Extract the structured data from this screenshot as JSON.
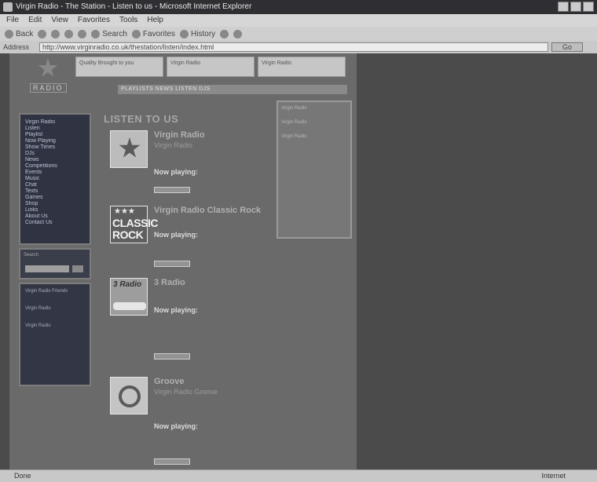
{
  "window": {
    "title": "Virgin Radio - The Station - Listen to us - Microsoft Internet Explorer"
  },
  "menu": [
    "File",
    "Edit",
    "View",
    "Favorites",
    "Tools",
    "Help"
  ],
  "toolbar": {
    "back": "Back",
    "search": "Search",
    "favorites": "Favorites",
    "history": "History"
  },
  "address": {
    "label": "Address",
    "url": "http://www.virginradio.co.uk/thestation/listen/index.html",
    "go": "Go"
  },
  "logo": {
    "text": "RADIO"
  },
  "promos": [
    "Quality Brought to you",
    "Virgin Radio",
    "Virgin Radio"
  ],
  "navstrip": "PLAYLISTS NEWS LISTEN DJS",
  "leftnav": {
    "items": [
      "Virgin Radio",
      "Listen",
      "Playlist",
      "Now Playing",
      "Show Times",
      "DJs",
      "News",
      "Competitions",
      "Events",
      "Music",
      "Chat",
      "Texts",
      "Games",
      "Shop",
      "Links",
      "About Us",
      "Contact Us"
    ]
  },
  "search": {
    "label": "Search"
  },
  "friends": {
    "text1": "Virgin Radio Friends",
    "text2": "Virgin Radio",
    "text3": "Virgin Radio"
  },
  "main": {
    "heading": "LISTEN TO US",
    "stations": [
      {
        "title": "Virgin Radio",
        "desc": "Virgin Radio",
        "now": "Now playing:"
      },
      {
        "title": "Virgin Radio Classic Rock",
        "desc": "CLASSIC ROCK",
        "now": "Now playing:"
      },
      {
        "title": "3 Radio",
        "desc": "3 Radio",
        "now": "Now playing:"
      },
      {
        "title": "Groove",
        "desc": "Virgin Radio Groove",
        "now": "Now playing:"
      }
    ]
  },
  "rightcol": {
    "text1": "Virgin Radio",
    "text2": "Virgin Radio",
    "text3": "Virgin Radio"
  },
  "status": {
    "left": "Done",
    "zone": "Internet"
  }
}
